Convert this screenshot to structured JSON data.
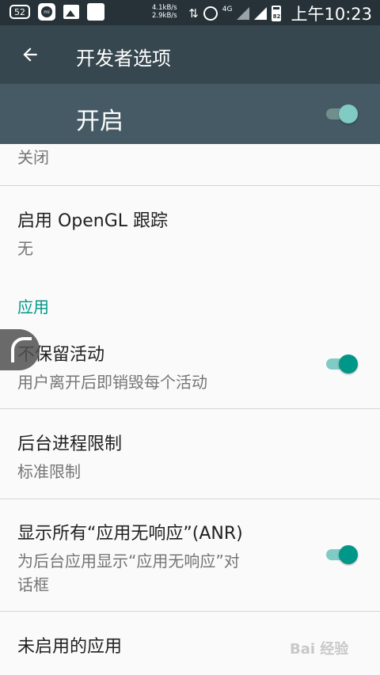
{
  "status_bar": {
    "notification_count": "52",
    "mi_label": "mi",
    "speed_up": "4.1kB/s",
    "speed_down": "2.9kB/s",
    "network": "4G",
    "battery": "82",
    "time": "上午10:23"
  },
  "app_bar": {
    "title": "开发者选项"
  },
  "master": {
    "label": "开启",
    "enabled": true
  },
  "items": [
    {
      "subtitle": "关闭"
    },
    {
      "title": "启用 OpenGL 跟踪",
      "subtitle": "无"
    },
    {
      "title": "不保留活动",
      "subtitle": "用户离开后即销毁每个活动",
      "enabled": true
    },
    {
      "title": "后台进程限制",
      "subtitle": "标准限制"
    },
    {
      "title": "显示所有“应用无响应”(ANR)",
      "subtitle_line1": "为后台应用显示“应用无响应”对",
      "subtitle_line2": "话框",
      "enabled": true
    },
    {
      "title": "未启用的应用"
    }
  ],
  "section": {
    "apps_header": "应用"
  },
  "watermark": "Bai 经验",
  "colors": {
    "status_bar": "#263238",
    "app_bar": "#37474f",
    "master_bar": "#455a64",
    "accent": "#009688",
    "background": "#fafafa"
  }
}
